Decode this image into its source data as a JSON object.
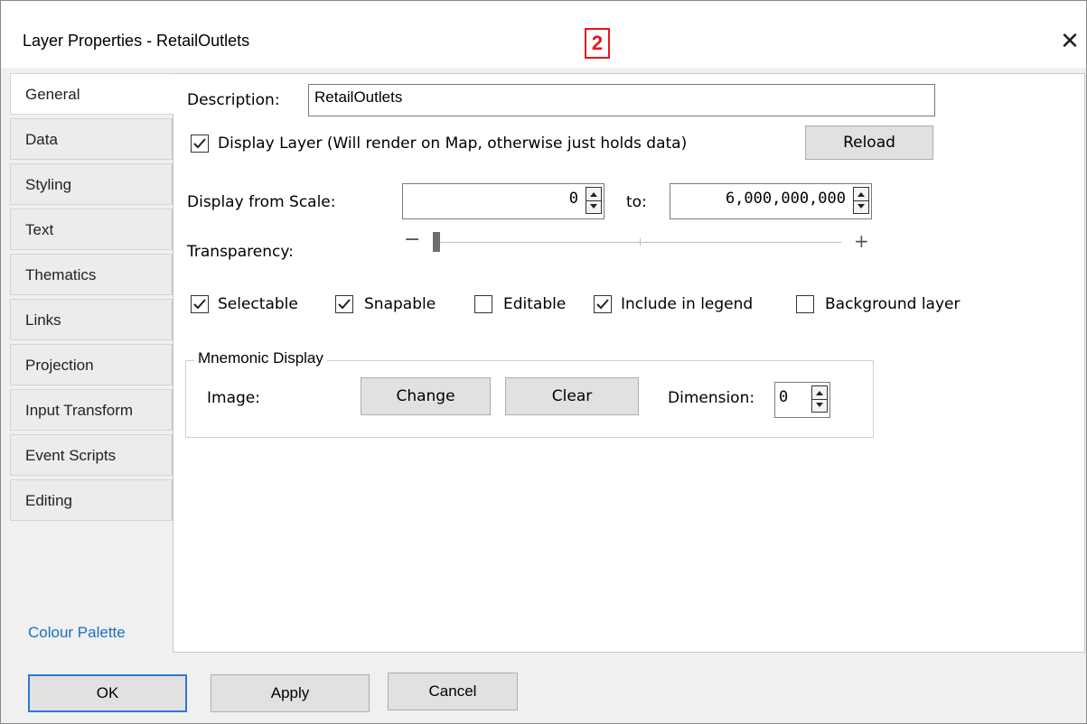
{
  "window": {
    "title": "Layer Properties - RetailOutlets",
    "badge": "2",
    "close_glyph": "✕"
  },
  "tabs": [
    {
      "label": "General",
      "active": true
    },
    {
      "label": "Data",
      "active": false
    },
    {
      "label": "Styling",
      "active": false
    },
    {
      "label": "Text",
      "active": false
    },
    {
      "label": "Thematics",
      "active": false
    },
    {
      "label": "Links",
      "active": false
    },
    {
      "label": "Projection",
      "active": false
    },
    {
      "label": "Input Transform",
      "active": false
    },
    {
      "label": "Event Scripts",
      "active": false
    },
    {
      "label": "Editing",
      "active": false
    }
  ],
  "colour_palette_link": "Colour Palette",
  "general": {
    "description_label": "Description:",
    "description_value": "RetailOutlets",
    "display_layer_label": "Display Layer (Will render on Map, otherwise just holds data)",
    "display_layer_checked": true,
    "reload_button": "Reload",
    "scale_label": "Display from Scale:",
    "scale_from": "0",
    "scale_to_label": "to:",
    "scale_to": "6,000,000,000",
    "transparency_label": "Transparency:",
    "transparency_value": 0,
    "slider_minus": "−",
    "slider_plus": "+",
    "options": [
      {
        "label": "Selectable",
        "checked": true
      },
      {
        "label": "Snapable",
        "checked": true
      },
      {
        "label": "Editable",
        "checked": false
      },
      {
        "label": "Include in legend",
        "checked": true
      },
      {
        "label": "Background layer",
        "checked": false
      }
    ]
  },
  "mnemonic": {
    "group_title": "Mnemonic Display",
    "image_label": "Image:",
    "change_button": "Change",
    "clear_button": "Clear",
    "dimension_label": "Dimension:",
    "dimension_value": "0"
  },
  "footer": {
    "ok": "OK",
    "apply": "Apply",
    "cancel": "Cancel"
  },
  "colors": {
    "accent": "#2a78d8",
    "badge": "#e8141b",
    "link": "#1a6fc4"
  }
}
